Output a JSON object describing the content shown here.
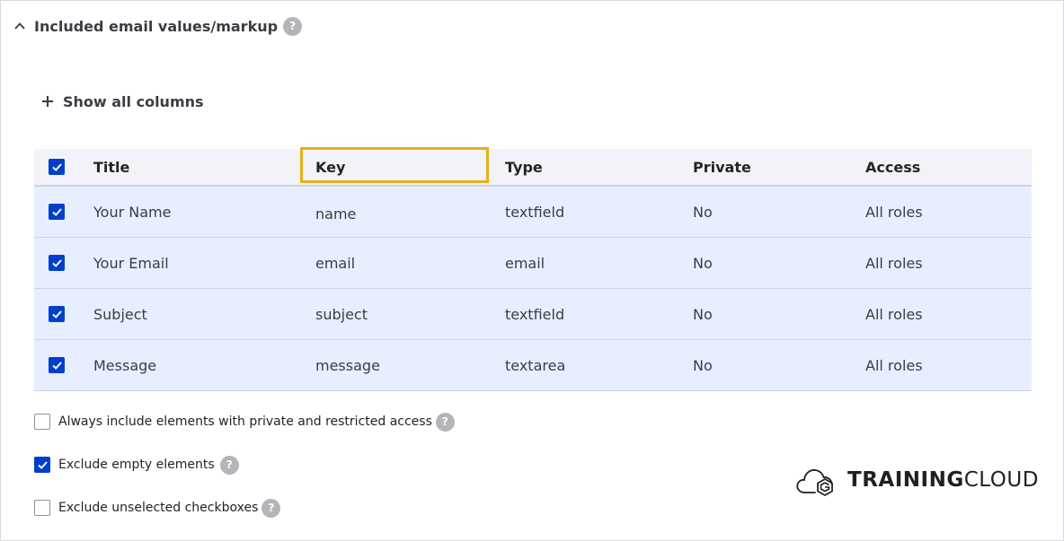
{
  "section": {
    "title": "Included email values/markup",
    "help": "?"
  },
  "show_all": {
    "label": "Show all columns"
  },
  "table": {
    "columns": [
      "Title",
      "Key",
      "Type",
      "Private",
      "Access"
    ],
    "select_all_checked": true,
    "rows": [
      {
        "title": "Your Name",
        "key": "name",
        "type": "textfield",
        "private": "No",
        "access": "All roles",
        "checked": true
      },
      {
        "title": "Your Email",
        "key": "email",
        "type": "email",
        "private": "No",
        "access": "All roles",
        "checked": true
      },
      {
        "title": "Subject",
        "key": "subject",
        "type": "textfield",
        "private": "No",
        "access": "All roles",
        "checked": true
      },
      {
        "title": "Message",
        "key": "message",
        "type": "textarea",
        "private": "No",
        "access": "All roles",
        "checked": true
      }
    ]
  },
  "options": [
    {
      "label": "Always include elements with private and restricted access",
      "checked": false,
      "help": "?"
    },
    {
      "label": "Exclude empty elements",
      "checked": true,
      "help": "?"
    },
    {
      "label": "Exclude unselected checkboxes",
      "checked": false,
      "help": "?"
    }
  ],
  "logo": {
    "part1": "TRAINING",
    "part2": "CLOUD"
  },
  "colors": {
    "accent": "#003ecc",
    "highlight": "#e6b01a",
    "row_bg": "#e7eeff"
  }
}
